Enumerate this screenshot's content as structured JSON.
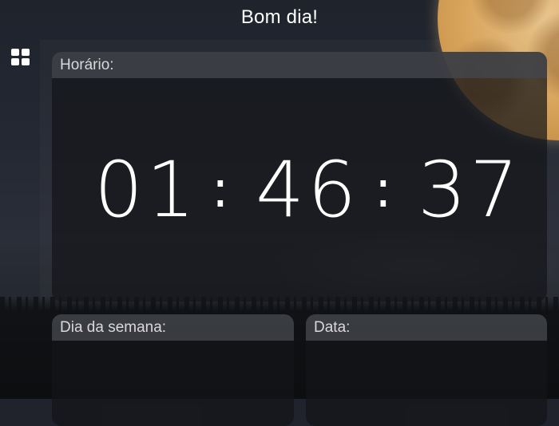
{
  "header": {
    "greeting": "Bom dia!"
  },
  "apps_button": {
    "icon": "grid-icon"
  },
  "time_panel": {
    "label": "Horário:",
    "hours": "01",
    "minutes": "46",
    "seconds": "37",
    "separator": ":"
  },
  "weekday_panel": {
    "label": "Dia da semana:",
    "value": ""
  },
  "date_panel": {
    "label": "Data:",
    "value": ""
  },
  "colors": {
    "text": "#ffffff",
    "panel_header_bg": "#44464c",
    "panel_body_bg": "#141519",
    "moon": "#d9a65e"
  }
}
